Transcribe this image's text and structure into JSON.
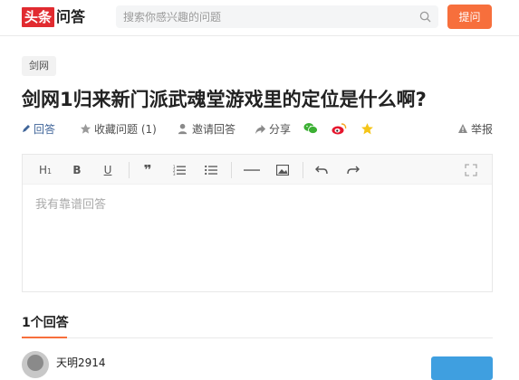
{
  "header": {
    "logo_red": "头条",
    "logo_dark": "问答",
    "search_placeholder": "搜索你感兴趣的问题",
    "ask_label": "提问"
  },
  "question": {
    "tag": "剑网",
    "title": "剑网1归来新门派武魂堂游戏里的定位是什么啊?"
  },
  "actions": {
    "answer": "回答",
    "collect": "收藏问题 (1)",
    "invite": "邀请回答",
    "share": "分享",
    "report": "举报"
  },
  "editor": {
    "placeholder": "我有靠谱回答",
    "tools": [
      "H1",
      "B",
      "U",
      "”",
      "ordered-list",
      "bullet-list",
      "divider",
      "image",
      "undo",
      "redo",
      "fullscreen"
    ]
  },
  "answers": {
    "count_label": "1个回答",
    "first_user": "天明2914"
  },
  "colors": {
    "brand_red": "#e12b30",
    "accent_orange": "#f76f3c",
    "link_blue": "#406599",
    "follow_blue": "#3f9fe0"
  }
}
